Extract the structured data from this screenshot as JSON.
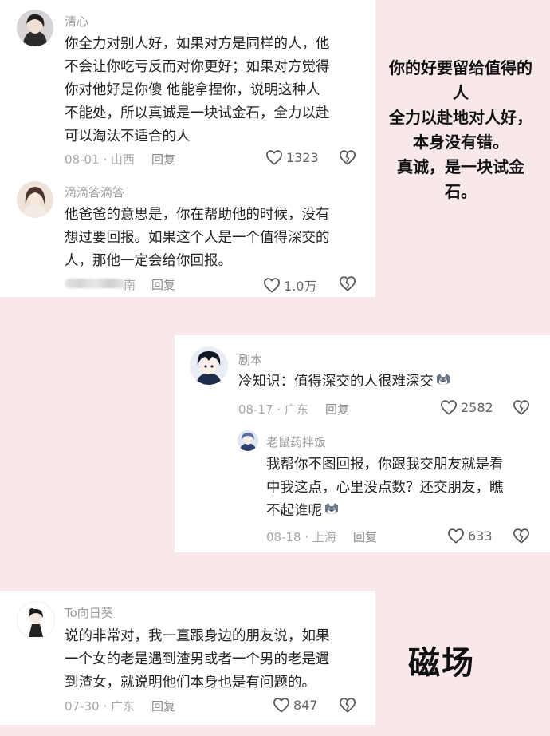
{
  "colors": {
    "background": "#f9e8ea",
    "card": "#ffffff",
    "username": "#9a9a9a",
    "meta": "#a8a8a8"
  },
  "comment1": {
    "user": "清心",
    "lines": [
      "你全力对别人好，如果对方是同样的人，他",
      "不会让你吃亏反而对你更好；如果对方觉得",
      "你对他好是你傻 他能拿捏你，说明这种人",
      "不能处，所以真诚是一块试金石，全力以赴",
      "可以淘汰不适合的人"
    ],
    "date": "08-01 · 山西",
    "reply": "回复",
    "likes": "1323",
    "avatar_icon": "woman-avatar-icon"
  },
  "comment2": {
    "user": "滴滴答滴答",
    "lines": [
      "他爸爸的意思是，你在帮助他的时候，没有",
      "想过要回报。如果这个人是一个值得深交的",
      "人，那他一定会给你回报。"
    ],
    "date_visible": "南",
    "reply": "回复",
    "likes": "1.0万",
    "avatar_icon": "girl-avatar-icon"
  },
  "comment3": {
    "user": "剧本",
    "text": "冷知识：值得深交的人很难深交",
    "emoji": "husky-dog-emoji",
    "date": "08-17 · 广东",
    "reply": "回复",
    "likes": "2582",
    "avatar_icon": "anime-boy-avatar-icon"
  },
  "reply3": {
    "user": "老鼠药拌饭",
    "lines": [
      "我帮你不图回报，你跟我交朋友就是看",
      "中我这点，心里没点数？还交朋友，瞧"
    ],
    "last": "不起谁呢",
    "emoji": "husky-dog-emoji",
    "date": "08-18 · 上海",
    "reply": "回复",
    "likes": "633",
    "avatar_icon": "anime-avatar-icon"
  },
  "comment4": {
    "user": "To向日葵",
    "lines": [
      "说的非常对，我一直跟身边的朋友说，如果",
      "一个女的老是遇到渣男或者一个男的老是遇",
      "到渣女，就说明他们本身也是有问题的。"
    ],
    "date": "07-30 · 广东",
    "reply": "回复",
    "likes": "847",
    "avatar_icon": "cartoon-girl-avatar-icon"
  },
  "note1": [
    "你的好要留给值得的",
    "人",
    "全力以赴地对人好，",
    "本身没有错。",
    "真诚，是一块试金",
    "石。"
  ],
  "note2": "磁场"
}
